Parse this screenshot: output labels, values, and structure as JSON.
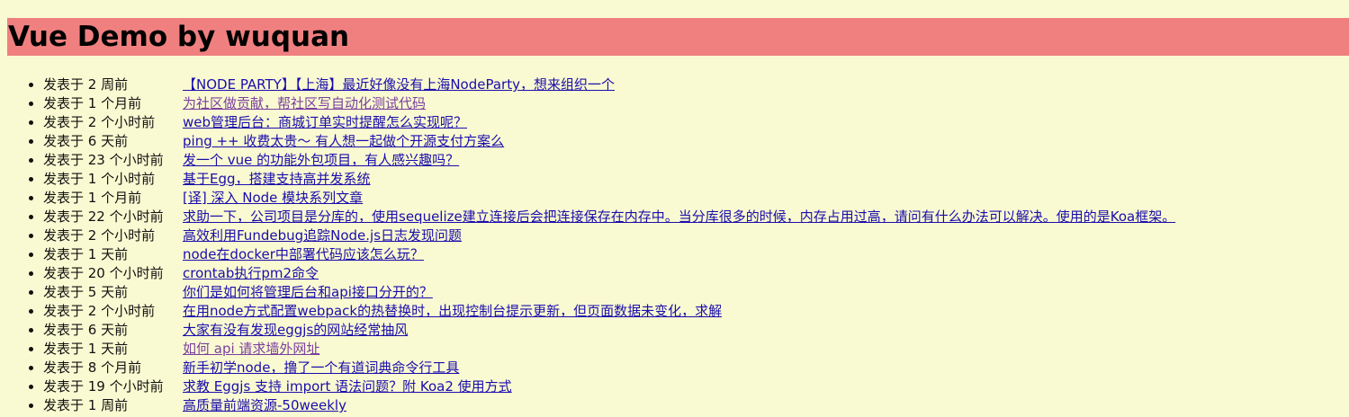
{
  "header": {
    "title": "Vue Demo by wuquan"
  },
  "topics": [
    {
      "time": "发表于 2 周前",
      "title": "【NODE PARTY】【上海】最近好像没有上海NodeParty，想来组织一个",
      "visited": false
    },
    {
      "time": "发表于 1 个月前",
      "title": "为社区做贡献，帮社区写自动化测试代码",
      "visited": true
    },
    {
      "time": "发表于 2 个小时前",
      "title": "web管理后台：商城订单实时提醒怎么实现呢？",
      "visited": false
    },
    {
      "time": "发表于 6 天前",
      "title": "ping ++ 收费太贵～ 有人想一起做个开源支付方案么",
      "visited": false
    },
    {
      "time": "发表于 23 个小时前",
      "title": "发一个 vue 的功能外包项目，有人感兴趣吗？",
      "visited": false
    },
    {
      "time": "发表于 1 个小时前",
      "title": "基于Egg，搭建支持高并发系统",
      "visited": false
    },
    {
      "time": "发表于 1 个月前",
      "title": "[译] 深入 Node 模块系列文章",
      "visited": false
    },
    {
      "time": "发表于 22 个小时前",
      "title": "求助一下，公司项目是分库的，使用sequelize建立连接后会把连接保存在内存中。当分库很多的时候，内存占用过高，请问有什么办法可以解决。使用的是Koa框架。",
      "visited": false
    },
    {
      "time": "发表于 2 个小时前",
      "title": "高效利用Fundebug追踪Node.js日志发现问题",
      "visited": false
    },
    {
      "time": "发表于 1 天前",
      "title": "node在docker中部署代码应该怎么玩？",
      "visited": false
    },
    {
      "time": "发表于 20 个小时前",
      "title": "crontab执行pm2命令",
      "visited": false
    },
    {
      "time": "发表于 5 天前",
      "title": "你们是如何将管理后台和api接口分开的？",
      "visited": false
    },
    {
      "time": "发表于 2 个小时前",
      "title": "在用node方式配置webpack的热替换时，出现控制台提示更新，但页面数据未变化，求解",
      "visited": false
    },
    {
      "time": "发表于 6 天前",
      "title": "大家有没有发现eggjs的网站经常抽风",
      "visited": false
    },
    {
      "time": "发表于 1 天前",
      "title": "如何 api 请求墙外网址",
      "visited": true
    },
    {
      "time": "发表于 8 个月前",
      "title": "新手初学node，撸了一个有道词典命令行工具",
      "visited": false
    },
    {
      "time": "发表于 19 个小时前",
      "title": "求教 Eggjs 支持 import 语法问题？附 Koa2 使用方式",
      "visited": false
    },
    {
      "time": "发表于 1 周前",
      "title": "高质量前端资源-50weekly",
      "visited": false
    }
  ]
}
